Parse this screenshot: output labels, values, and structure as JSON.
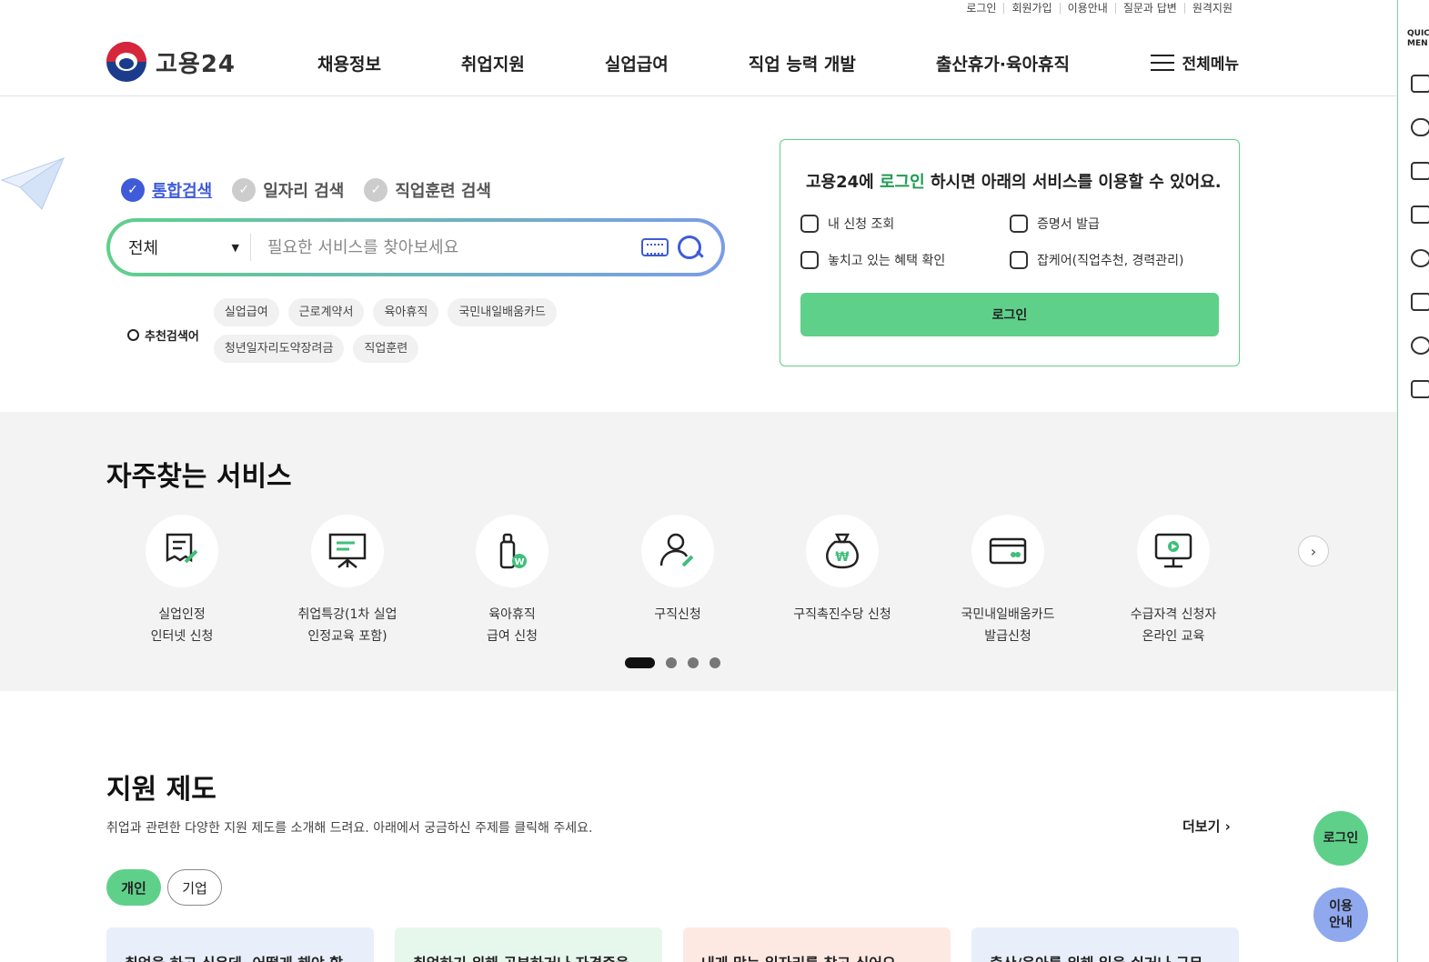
{
  "util_links": [
    "로그인",
    "회원가입",
    "이용안내",
    "질문과 답변",
    "원격지원"
  ],
  "logo": {
    "text": "고용24"
  },
  "gnb": [
    "채용정보",
    "취업지원",
    "실업급여",
    "직업 능력 개발",
    "출산휴가·육아휴직"
  ],
  "all_menu": "전체메뉴",
  "quick": {
    "title": "QUICK\nMENU"
  },
  "search": {
    "tabs": [
      "통합검색",
      "일자리 검색",
      "직업훈련 검색"
    ],
    "category": "전체",
    "placeholder": "필요한 서비스를 찾아보세요",
    "rec_label": "추천검색어",
    "chips": [
      "실업급여",
      "근로계약서",
      "육아휴직",
      "국민내일배움카드",
      "청년일자리도약장려금",
      "직업훈련"
    ]
  },
  "login_box": {
    "title_pre": "고용24에 ",
    "title_hl": "로그인",
    "title_post": " 하시면 아래의 서비스를 이용할 수 있어요.",
    "items": [
      "내 신청 조회",
      "증명서 발급",
      "놓치고 있는 혜택 확인",
      "잡케어(직업추천, 경력관리)"
    ],
    "button": "로그인"
  },
  "services": {
    "title": "자주찾는 서비스",
    "items": [
      {
        "line1": "실업인정",
        "line2": "인터넷 신청",
        "icon": "document-pen-icon"
      },
      {
        "line1": "취업특강(1차 실업",
        "line2": "인정교육 포함)",
        "icon": "presentation-board-icon"
      },
      {
        "line1": "육아휴직",
        "line2": "급여 신청",
        "icon": "baby-bottle-icon"
      },
      {
        "line1": "구직신청",
        "line2": "",
        "icon": "person-pen-icon"
      },
      {
        "line1": "구직촉진수당 신청",
        "line2": "",
        "icon": "money-bag-icon"
      },
      {
        "line1": "국민내일배움카드",
        "line2": "발급신청",
        "icon": "card-icon"
      },
      {
        "line1": "수급자격 신청자",
        "line2": "온라인 교육",
        "icon": "monitor-play-icon"
      }
    ]
  },
  "support": {
    "title": "지원 제도",
    "desc": "취업과 관련한 다양한 지원 제도를 소개해 드려요. 아래에서 궁금하신 주제를 클릭해 주세요.",
    "more": "더보기 ›",
    "tabs": [
      "개인",
      "기업"
    ],
    "cards": [
      "취업을 하고 싶은데, 어떻게 해야 할",
      "취업하기 위해 공부하거나 자격증을",
      "내게 맞는 일자리를 찾고 싶어요",
      "출산/육아를 위해 일을 쉬거나 근무"
    ]
  },
  "floating": {
    "login": "로그인",
    "guide_1": "이용",
    "guide_2": "안내"
  },
  "colors": {
    "brand_green": "#5fd08a",
    "brand_blue": "#3f5bd8",
    "hl_green": "#1f9a52"
  }
}
